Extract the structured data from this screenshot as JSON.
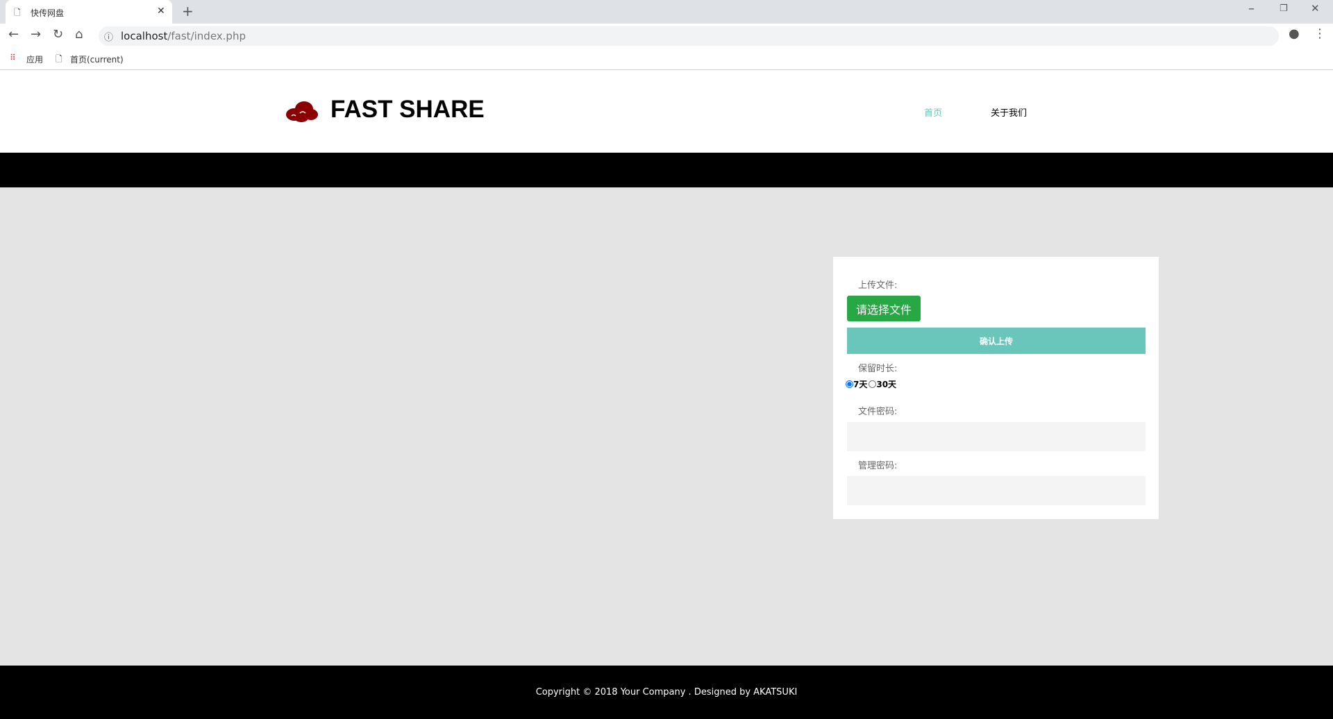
{
  "browser": {
    "tab_title": "快传网盘",
    "url_host": "localhost",
    "url_path": "/fast/index.php",
    "bookmarks": [
      {
        "label": "应用"
      },
      {
        "label": "首页(current)"
      }
    ]
  },
  "header": {
    "brand": "FAST SHARE",
    "nav": [
      {
        "label": "首页",
        "active": true
      },
      {
        "label": "关于我们"
      }
    ]
  },
  "form": {
    "upload_label": "上传文件:",
    "choose_file": "请选择文件",
    "confirm": "确认上传",
    "duration_label": "保留时长:",
    "options": [
      {
        "label": "7天",
        "checked": true
      },
      {
        "label": "30天",
        "checked": false
      }
    ],
    "file_password_label": "文件密码:",
    "file_password_value": "",
    "admin_password_label": "管理密码:",
    "admin_password_value": ""
  },
  "footer": {
    "text": "Copyright © 2018 Your Company . Designed by AKATSUKI"
  },
  "colors": {
    "accent": "#6ac6bb",
    "green": "#28a745",
    "logo": "#8b0000"
  }
}
